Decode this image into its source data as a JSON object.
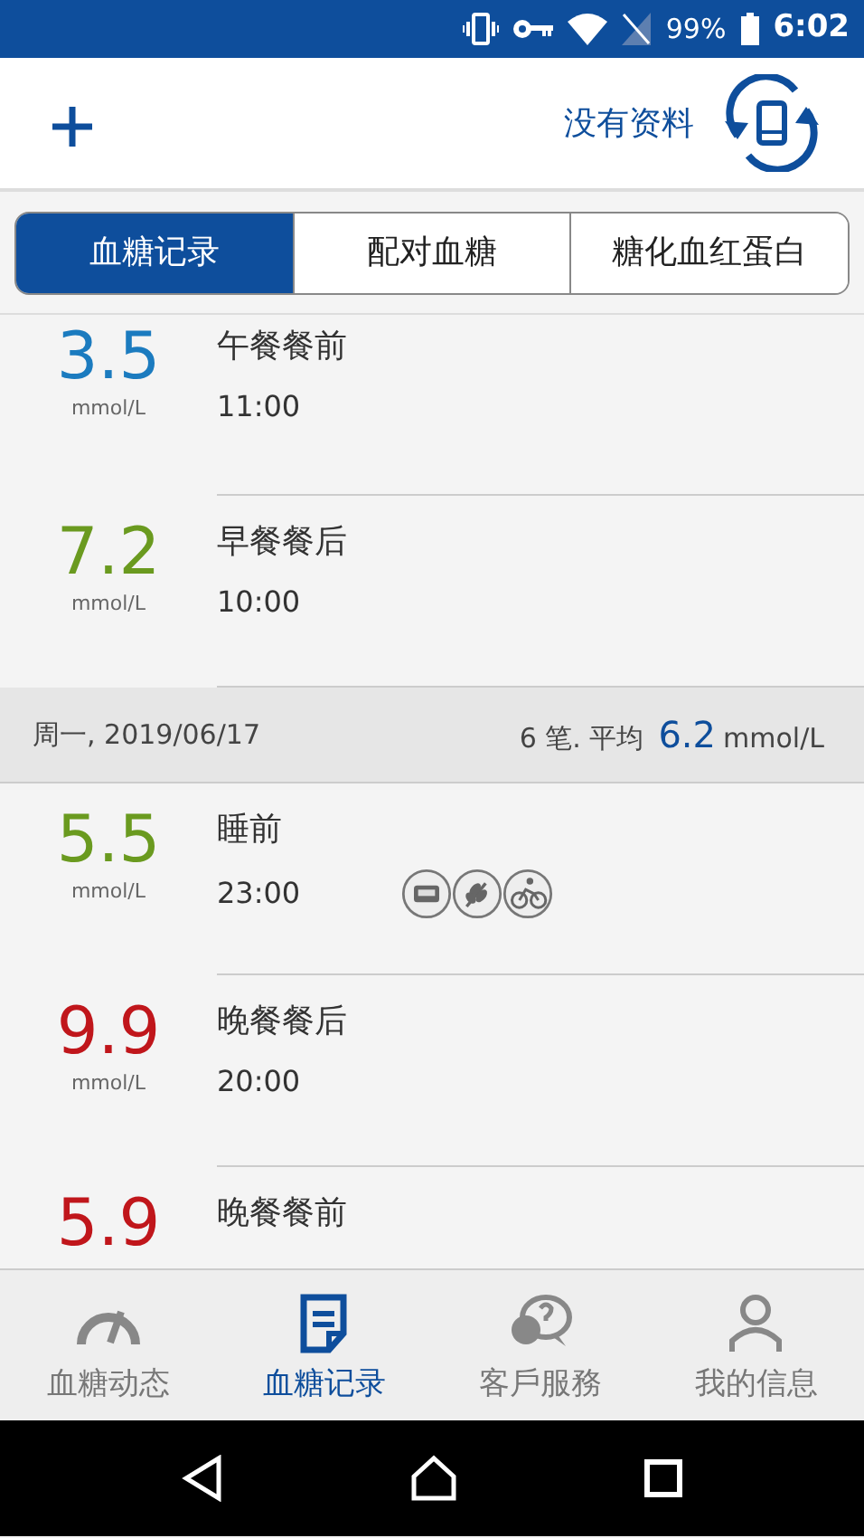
{
  "status_bar": {
    "battery": "99%",
    "time": "6:02"
  },
  "header": {
    "sync_label": "没有资料"
  },
  "tabs": [
    {
      "label": "血糖记录",
      "selected": true
    },
    {
      "label": "配对血糖",
      "selected": false
    },
    {
      "label": "糖化血红蛋白",
      "selected": false
    }
  ],
  "list": [
    {
      "kind": "reading",
      "value": "3.5",
      "unit": "mmol/L",
      "label": "午餐餐前",
      "time": "11:00",
      "color": "#1b7bbf"
    },
    {
      "kind": "reading",
      "value": "7.2",
      "unit": "mmol/L",
      "label": "早餐餐后",
      "time": "10:00",
      "color": "#6a9a1f"
    },
    {
      "kind": "day",
      "date": "周一, 2019/06/17",
      "count": "6 笔. 平均",
      "average": "6.2",
      "unit": "mmol/L"
    },
    {
      "kind": "reading",
      "value": "5.5",
      "unit": "mmol/L",
      "label": "睡前",
      "time": "23:00",
      "color": "#6a9a1f",
      "icons": [
        {
          "kind": "meter"
        },
        {
          "kind": "grain"
        },
        {
          "kind": "bike"
        }
      ]
    },
    {
      "kind": "reading",
      "value": "9.9",
      "unit": "mmol/L",
      "label": "晚餐餐后",
      "time": "20:00",
      "color": "#c0161b"
    },
    {
      "kind": "reading",
      "value": "5.9",
      "label": "晚餐餐前",
      "color": "#c0161b"
    }
  ],
  "bottom_nav": [
    {
      "kind": "gauge",
      "label": "血糖动态",
      "selected": false
    },
    {
      "kind": "note",
      "label": "血糖记录",
      "selected": true
    },
    {
      "kind": "chat",
      "label": "客戶服務",
      "selected": false
    },
    {
      "kind": "person",
      "label": "我的信息",
      "selected": false
    }
  ]
}
